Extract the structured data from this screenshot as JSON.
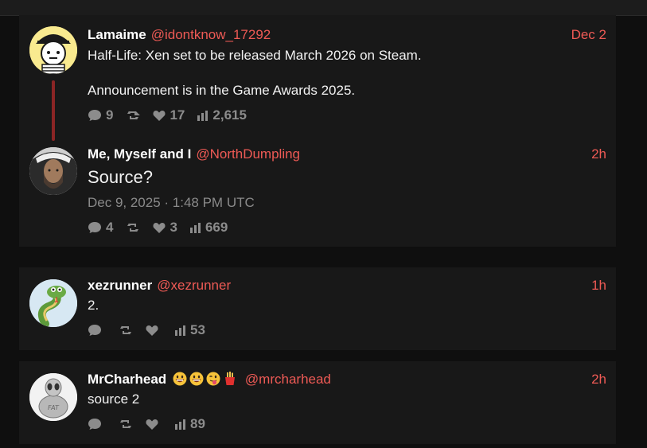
{
  "colors": {
    "accent": "#ee5a55",
    "background": "#0f0f0f",
    "card": "#181818",
    "thread_line": "#8b2525",
    "muted": "#8a8a8a"
  },
  "posts": [
    {
      "display_name": "Lamaime",
      "handle": "@idontknow_17292",
      "time": "Dec 2",
      "text_line1": "Half-Life: Xen set to be released March 2026 on Steam.",
      "text_line2": "Announcement is in the Game Awards 2025.",
      "replies": "9",
      "retweets": "",
      "likes": "17",
      "views": "2,615"
    },
    {
      "display_name": "Me, Myself and I",
      "handle": "@NorthDumpling",
      "time": "2h",
      "text": "Source?",
      "date": "Dec 9, 2025 · 1:48 PM UTC",
      "replies": "4",
      "retweets": "",
      "likes": "3",
      "views": "669"
    },
    {
      "display_name": "xezrunner",
      "handle": "@xezrunner",
      "time": "1h",
      "text": "2.",
      "replies": "",
      "retweets": "",
      "likes": "",
      "views": "53"
    },
    {
      "display_name": "MrCharhead",
      "handle": "@mrcharhead",
      "time": "2h",
      "text": "source 2",
      "replies": "",
      "retweets": "",
      "likes": "",
      "views": "89",
      "name_emojis": [
        "grinning-face-emoji",
        "grinning-face-emoji",
        "winking-tongue-face-emoji",
        "french-fries-emoji"
      ]
    }
  ],
  "icons": {
    "reply": "comment-icon",
    "retweet": "retweet-icon",
    "like": "heart-icon",
    "views": "bar-chart-icon"
  }
}
